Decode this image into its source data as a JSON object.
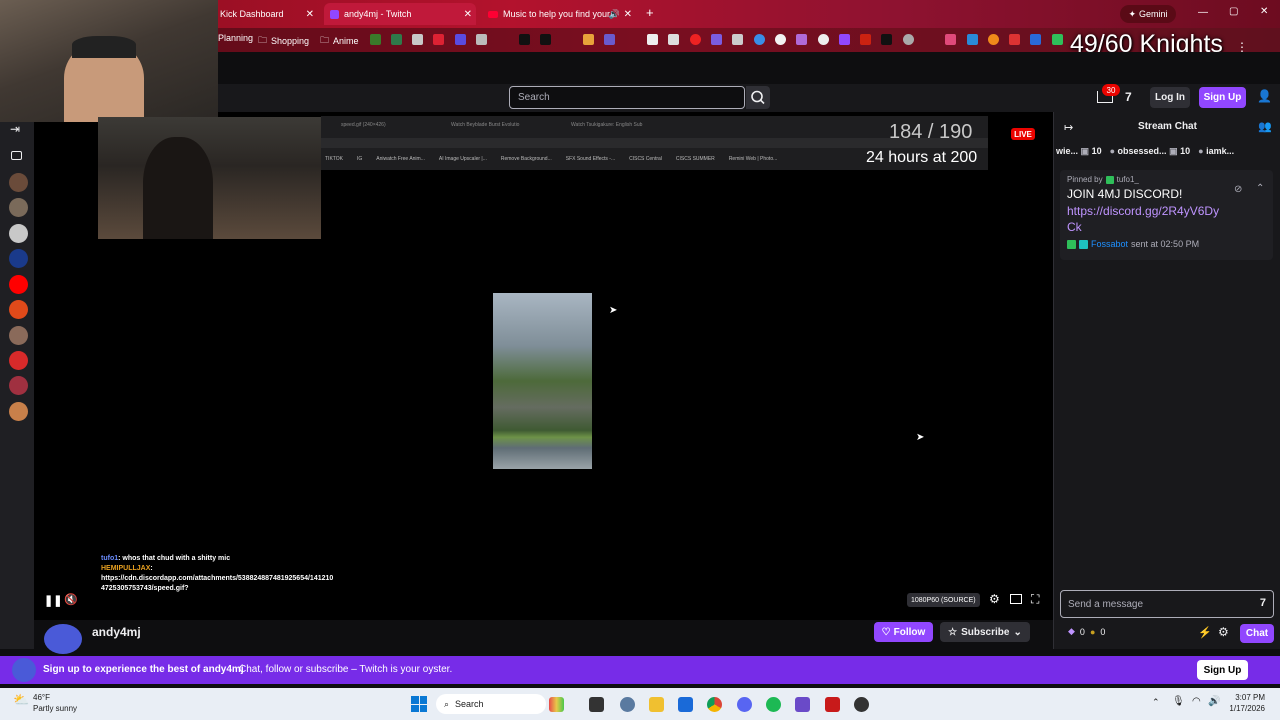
{
  "browser": {
    "tabs": [
      {
        "label": "Kick Dashboard"
      },
      {
        "label": "andy4mj - Twitch"
      },
      {
        "label": "Music to help you find your"
      }
    ],
    "gemini_label": "Gemini",
    "bookmarks": [
      {
        "label": "Planning"
      },
      {
        "label": "Shopping"
      },
      {
        "label": "Anime"
      }
    ]
  },
  "overlay": {
    "knights_counter": "49/60 Knights",
    "progress_counter": "184 / 190",
    "hours_label": "24 hours at 200"
  },
  "header": {
    "search_placeholder": "Search",
    "notif_count": "30",
    "login_label": "Log In",
    "signup_label": "Sign Up"
  },
  "player": {
    "live_badge": "LIVE",
    "quality_label": "1080P60 (SOURCE)",
    "chat_overlay": [
      {
        "user": "tufo1",
        "text": ": whos that chud with a shitty mic"
      },
      {
        "user": "HEMIPULLJAX",
        "text": ":"
      },
      {
        "user": "",
        "text": "https://cdn.discordapp.com/attachments/538824887481925654/141210"
      },
      {
        "user": "",
        "text": "4725305753743/speed.gif?"
      }
    ],
    "screen_tabs": [
      "speed.gif (240×426)",
      "Watch Beyblade Burst Evolutio",
      "Watch Tsukigakure: English Sub"
    ],
    "screen_bookmarks": [
      "TIKTOK",
      "IG",
      "Aniwatch Free Anim...",
      "AI Image Upscaler |...",
      "Remove Background...",
      "SFX Sound Effects -...",
      "CISCS Central",
      "CISCS SUMMER",
      "Remini Web | Photo..."
    ]
  },
  "chat": {
    "title": "Stream Chat",
    "top_chatters": [
      {
        "name": "wie...",
        "count": "10"
      },
      {
        "name": "obsessed...",
        "count": "10"
      },
      {
        "name": "iamk...",
        "count": ""
      }
    ],
    "pinned_by_label": "Pinned by",
    "pinned_by_user": "tufo1_",
    "pinned_text": "JOIN 4MJ DISCORD!",
    "pinned_link": "https://discord.gg/2R4yV6DyCk",
    "pinned_sender": "Fossabot",
    "pinned_time": "sent at 02:50 PM",
    "input_placeholder": "Send a message",
    "points_a": "0",
    "points_b": "0",
    "chat_button": "Chat"
  },
  "channel": {
    "name": "andy4mj",
    "follow_label": "Follow",
    "subscribe_label": "Subscribe"
  },
  "banner": {
    "headline": "Sign up to experience the best of andy4mj",
    "subtext": "Chat, follow or subscribe – Twitch is your oyster.",
    "button": "Sign Up"
  },
  "taskbar": {
    "temp": "46°F",
    "weather": "Partly sunny",
    "search_label": "Search",
    "time": "3:07 PM",
    "date": "1/17/2026"
  },
  "colors": {
    "twitch_purple": "#9147ff",
    "live_red": "#eb0400",
    "browser_red": "#b3122d"
  }
}
